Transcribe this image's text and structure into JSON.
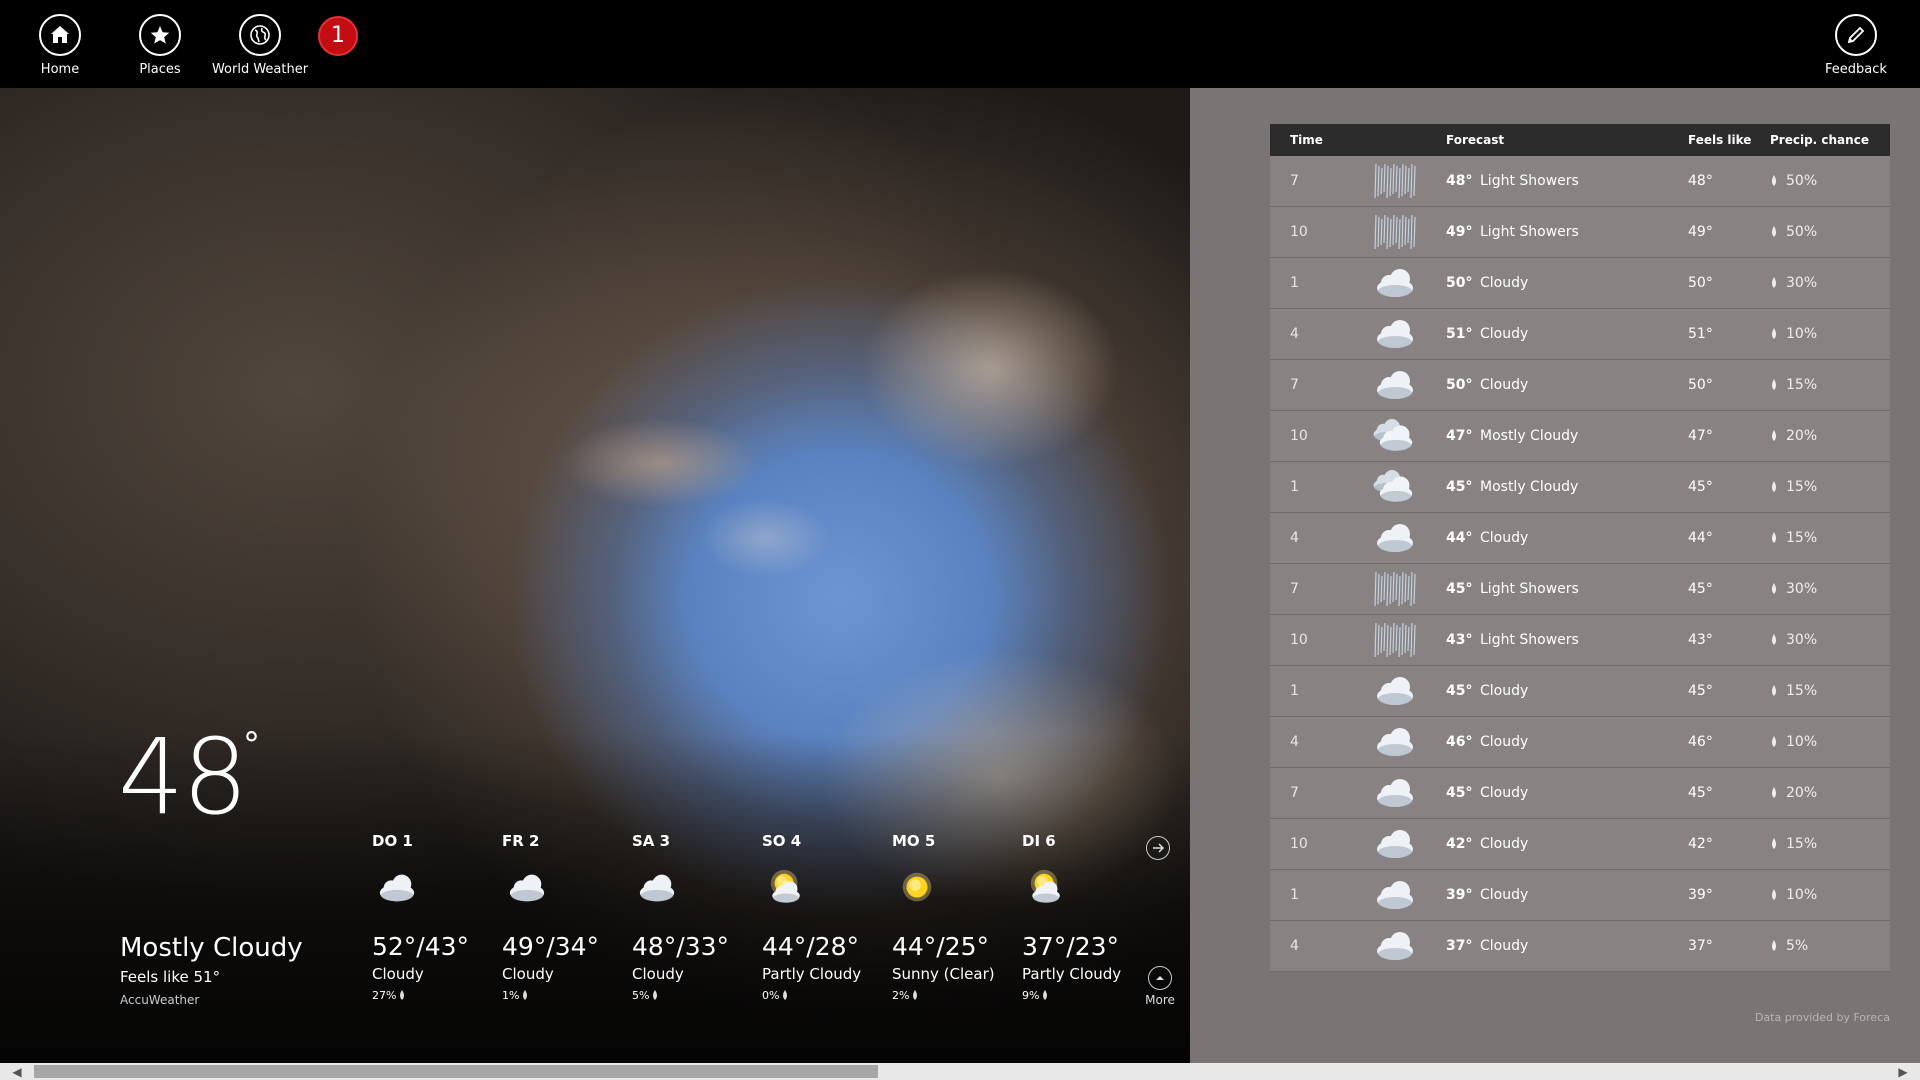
{
  "appbar": {
    "home_label": "Home",
    "places_label": "Places",
    "world_label": "World Weather",
    "badge_count": "1",
    "feedback_label": "Feedback"
  },
  "current": {
    "temp": "48",
    "deg": "°",
    "condition": "Mostly Cloudy",
    "feels_like": "Feels like 51°",
    "provider": "AccuWeather"
  },
  "daily": [
    {
      "day": "DO 1",
      "temp": "52°/43°",
      "condition": "Cloudy",
      "precip": "27%",
      "icon": "cloudy-icon"
    },
    {
      "day": "FR 2",
      "temp": "49°/34°",
      "condition": "Cloudy",
      "precip": "1%",
      "icon": "cloudy-icon"
    },
    {
      "day": "SA 3",
      "temp": "48°/33°",
      "condition": "Cloudy",
      "precip": "5%",
      "icon": "cloudy-icon"
    },
    {
      "day": "SO 4",
      "temp": "44°/28°",
      "condition": "Partly Cloudy",
      "precip": "0%",
      "icon": "partly-cloudy-icon"
    },
    {
      "day": "MO 5",
      "temp": "44°/25°",
      "condition": "Sunny (Clear)",
      "precip": "2%",
      "icon": "sunny-icon"
    },
    {
      "day": "DI 6",
      "temp": "37°/23°",
      "condition": "Partly Cloudy",
      "precip": "9%",
      "icon": "partly-cloudy-icon"
    }
  ],
  "more_label": "More",
  "hourly": {
    "headers": {
      "time": "Time",
      "forecast": "Forecast",
      "feels": "Feels like",
      "precip": "Precip. chance"
    },
    "rows": [
      {
        "time": "7",
        "temp": "48°",
        "condition": "Light Showers",
        "feels": "48°",
        "precip": "50%",
        "icon": "showers-icon"
      },
      {
        "time": "10",
        "temp": "49°",
        "condition": "Light Showers",
        "feels": "49°",
        "precip": "50%",
        "icon": "showers-icon"
      },
      {
        "time": "1",
        "temp": "50°",
        "condition": "Cloudy",
        "feels": "50°",
        "precip": "30%",
        "icon": "cloudy-icon"
      },
      {
        "time": "4",
        "temp": "51°",
        "condition": "Cloudy",
        "feels": "51°",
        "precip": "10%",
        "icon": "cloudy-icon"
      },
      {
        "time": "7",
        "temp": "50°",
        "condition": "Cloudy",
        "feels": "50°",
        "precip": "15%",
        "icon": "cloudy-icon"
      },
      {
        "time": "10",
        "temp": "47°",
        "condition": "Mostly Cloudy",
        "feels": "47°",
        "precip": "20%",
        "icon": "mostly-cloudy-icon"
      },
      {
        "time": "1",
        "temp": "45°",
        "condition": "Mostly Cloudy",
        "feels": "45°",
        "precip": "15%",
        "icon": "mostly-cloudy-icon"
      },
      {
        "time": "4",
        "temp": "44°",
        "condition": "Cloudy",
        "feels": "44°",
        "precip": "15%",
        "icon": "cloudy-icon"
      },
      {
        "time": "7",
        "temp": "45°",
        "condition": "Light Showers",
        "feels": "45°",
        "precip": "30%",
        "icon": "showers-icon"
      },
      {
        "time": "10",
        "temp": "43°",
        "condition": "Light Showers",
        "feels": "43°",
        "precip": "30%",
        "icon": "showers-icon"
      },
      {
        "time": "1",
        "temp": "45°",
        "condition": "Cloudy",
        "feels": "45°",
        "precip": "15%",
        "icon": "cloudy-icon"
      },
      {
        "time": "4",
        "temp": "46°",
        "condition": "Cloudy",
        "feels": "46°",
        "precip": "10%",
        "icon": "cloudy-icon"
      },
      {
        "time": "7",
        "temp": "45°",
        "condition": "Cloudy",
        "feels": "45°",
        "precip": "20%",
        "icon": "cloudy-icon"
      },
      {
        "time": "10",
        "temp": "42°",
        "condition": "Cloudy",
        "feels": "42°",
        "precip": "15%",
        "icon": "cloudy-icon"
      },
      {
        "time": "1",
        "temp": "39°",
        "condition": "Cloudy",
        "feels": "39°",
        "precip": "10%",
        "icon": "cloudy-icon"
      },
      {
        "time": "4",
        "temp": "37°",
        "condition": "Cloudy",
        "feels": "37°",
        "precip": "5%",
        "icon": "cloudy-icon"
      }
    ],
    "provider": "Data provided by Foreca"
  },
  "colors": {
    "badge": "#c40d12",
    "right_panel": "#7a7574",
    "row_bg": "#888382",
    "header_bg": "#2c2c2c",
    "sky": "#6e95d3"
  }
}
